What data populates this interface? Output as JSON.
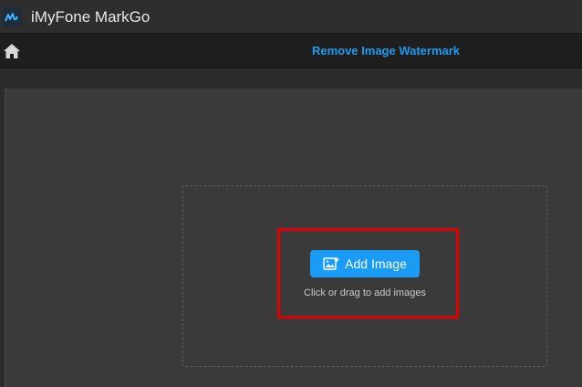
{
  "window": {
    "title": "iMyFone MarkGo",
    "logo_icon": "markgo-logo-icon"
  },
  "header": {
    "home_icon": "home-icon",
    "page_title": "Remove Image Watermark",
    "title_color": "#1e9bf0"
  },
  "dropzone": {
    "add_button_label": "Add Image",
    "add_button_icon": "add-image-icon",
    "hint": "Click or drag to add images",
    "accent_color": "#1a9bf5",
    "highlight_color": "#e00000"
  }
}
